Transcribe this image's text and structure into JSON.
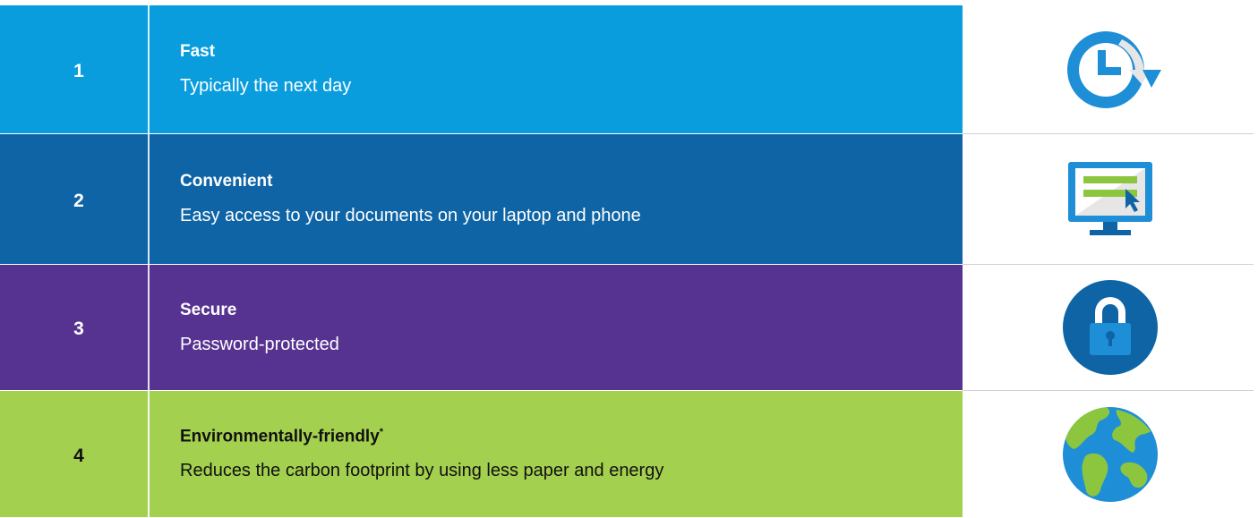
{
  "rows": [
    {
      "number": "1",
      "title": "Fast",
      "description": "Typically the next day",
      "icon": "clock-refresh-icon",
      "color": "#0a9ddd"
    },
    {
      "number": "2",
      "title": "Convenient",
      "description": "Easy access to your documents on your laptop and phone",
      "icon": "monitor-icon",
      "color": "#0e64a5"
    },
    {
      "number": "3",
      "title": "Secure",
      "description": "Password-protected",
      "icon": "lock-icon",
      "color": "#573391"
    },
    {
      "number": "4",
      "title": "Environmentally-friendly",
      "title_mark": "*",
      "description": "Reduces the carbon footprint by using less paper and energy",
      "icon": "globe-icon",
      "color": "#a4d04f"
    }
  ],
  "icon_colors": {
    "primary_blue": "#1e8ed6",
    "dark_blue": "#0e64a5",
    "light_gray": "#e6e6e6",
    "green": "#8cc63f"
  }
}
